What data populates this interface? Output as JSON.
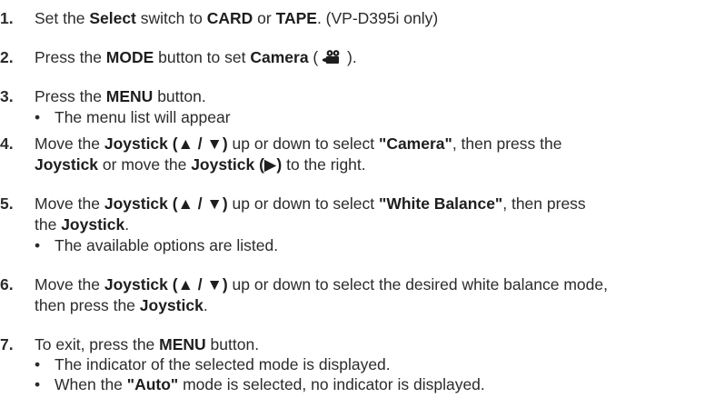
{
  "steps": [
    {
      "num": "1.",
      "lines": [
        {
          "p1": "Set the ",
          "b1": "Select",
          "p2": " switch to ",
          "b2": "CARD",
          "p3": " or ",
          "b3": "TAPE",
          "p4": ". (VP-D395i only)"
        }
      ]
    },
    {
      "num": "2.",
      "lines": [
        {
          "p1": "Press the ",
          "b1": "MODE",
          "p2": " button to set ",
          "b2": "Camera",
          "p3": " ( ",
          "p4": " )."
        }
      ]
    },
    {
      "num": "3.",
      "lines": [
        {
          "p1": "Press the ",
          "b1": "MENU",
          "p2": " button."
        }
      ],
      "bullets": [
        "The menu list will appear"
      ]
    },
    {
      "num": "4.",
      "lines": [
        {
          "p1": "Move the ",
          "b1": "Joystick (▲ / ▼)",
          "p2": " up or down to select ",
          "b2": "\"Camera\"",
          "p3": ", then press the"
        },
        {
          "b1": "Joystick",
          "p1": " or move the ",
          "b2": "Joystick (▶)",
          "p2": " to the right."
        }
      ]
    },
    {
      "num": "5.",
      "lines": [
        {
          "p1": "Move the ",
          "b1": "Joystick (▲ / ▼)",
          "p2": " up or down to select ",
          "b2": "\"White Balance\"",
          "p3": ", then press"
        },
        {
          "p1": "the ",
          "b1": "Joystick",
          "p2": "."
        }
      ],
      "bullets": [
        "The available options are listed."
      ]
    },
    {
      "num": "6.",
      "lines": [
        {
          "p1": "Move the ",
          "b1": "Joystick (▲ / ▼)",
          "p2": " up or down to select the desired white balance mode,"
        },
        {
          "p1": "then press the ",
          "b1": "Joystick",
          "p2": "."
        }
      ]
    },
    {
      "num": "7.",
      "lines": [
        {
          "p1": "To exit, press the ",
          "b1": "MENU",
          "p2": " button."
        }
      ],
      "bullets": [
        "The indicator of the selected mode is displayed."
      ],
      "bullet_auto": {
        "p1": "When the ",
        "b1": "\"Auto\"",
        "p2": " mode is selected, no indicator is displayed."
      }
    }
  ],
  "bullet_char": "•",
  "icons": {
    "camera_mode": "camera-mode-icon"
  }
}
